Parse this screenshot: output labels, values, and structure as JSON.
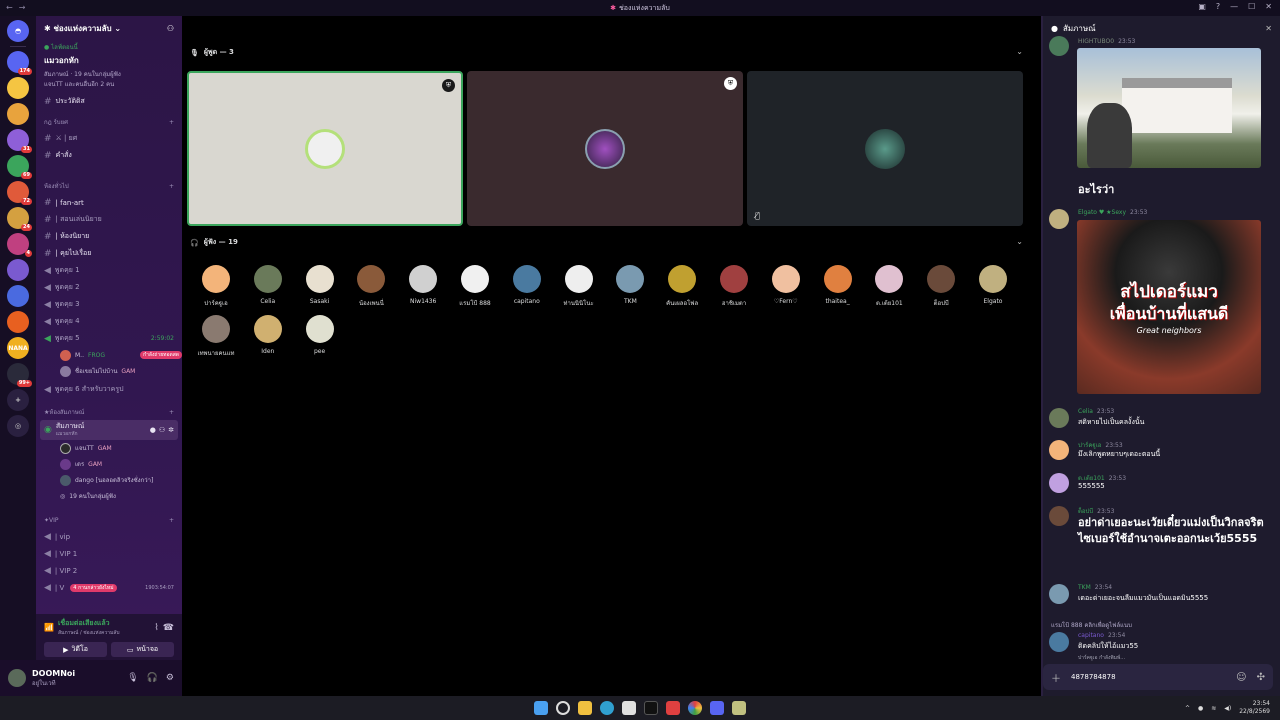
{
  "window": {
    "title": "ช่องแห่งความลับ"
  },
  "servers": [
    {
      "badge": "174",
      "color": "#5865f2"
    },
    {
      "badge": "",
      "color": "#f5c542"
    },
    {
      "badge": "",
      "color": "#e8a33d"
    },
    {
      "badge": "31",
      "color": "#8e5fd8"
    },
    {
      "badge": "69",
      "color": "#3ba55c"
    },
    {
      "badge": "72",
      "color": "#e05a3a"
    },
    {
      "badge": "24",
      "color": "#d4a040"
    },
    {
      "badge": "4",
      "color": "#c04080"
    },
    {
      "badge": "",
      "color": "#7a5ad0"
    },
    {
      "badge": "",
      "color": "#4a6ae0"
    },
    {
      "badge": "",
      "color": "#e86020"
    },
    {
      "badge": "",
      "color": "#f0b020",
      "label": "NANA"
    },
    {
      "badge": "99+",
      "color": "#2a2a3a"
    }
  ],
  "sidebar": {
    "server_name": "ช่องแห่งความลับ",
    "event": {
      "live": "● ไลฟ์ตอนนี้",
      "title": "แมวอกหัก",
      "line1": "สัมภาษณ์ · 19 คนในกลุ่มผู้ฟัง",
      "line2": "แจนTT และคนอื่นอีก 2 คน"
    },
    "history": "ประวัติดิส",
    "cat_rules": "กฎ ร์บยศ",
    "rules_items": [
      "⚔ | ยศ",
      "คำสั่ง"
    ],
    "cat_general": "ห้องทั่วไป",
    "general_items": [
      "| fan-art",
      "| สอนเล่นนิยาย",
      "| ห้องนิยาย",
      "| คุยไปเรื่อย"
    ],
    "voice_items": [
      "พูดคุย 1",
      "พูดคุย 2",
      "พูดคุย 3",
      "พูดคุย 4",
      "พูดคุย 5"
    ],
    "voice5_time": "2:59:02",
    "voice5_users": [
      {
        "name": "M..",
        "tag": "FROG",
        "live": "กำลังถ่ายทอดสด"
      },
      {
        "name": "ชื่อเขยไม่ไปบ้าน",
        "tag": "GAM"
      }
    ],
    "voice6": "พูดคุย 6 สำหรับวาครูป",
    "cat_stage": "ห้องสัมภาษณ์",
    "stage_name": "สัมภาษณ์",
    "stage_sub": "แมวอกหัก",
    "stage_users": [
      {
        "name": "แจนTT",
        "tag": "GAM"
      },
      {
        "name": "เดร",
        "tag": "GAM"
      },
      {
        "name": "dango [นอลอดลิวจริงซั่งกว่า]",
        "tag": ""
      },
      {
        "name": "19 คนในกลุ่มผู้ฟัง",
        "tag": ""
      }
    ],
    "cat_vip": "VIP",
    "vip_items": [
      "| vip",
      "| VIP 1",
      "| VIP 2",
      "| V"
    ],
    "vip_tag": "4 กานกล่าวยังไหม่",
    "vip_time": "1903:54:07"
  },
  "voice_connection": {
    "status": "เชื่อมต่อเสียงแล้ว",
    "sub": "สัมภาษณ์ / ช่องแห่งความลับ",
    "video_btn": "วิดีโอ",
    "screen_btn": "หน้าจอ"
  },
  "user": {
    "name": "DOOMNoi",
    "status": "อยู่ในเวที"
  },
  "stage": {
    "speakers_label": "ผู้พูด — 3",
    "listeners_label": "ผู้ฟัง — 19",
    "speaker_colors": [
      "#d9d7d0",
      "#3a2a2e",
      "#1f2328"
    ],
    "listeners": [
      {
        "name": "ปาร์คฐูเอ",
        "color": "#f3b47a"
      },
      {
        "name": "Celia",
        "color": "#6a7a5a"
      },
      {
        "name": "Sasaki",
        "color": "#e8e0d0"
      },
      {
        "name": "น้องเพนนี่",
        "color": "#8a5a3a"
      },
      {
        "name": "Niw1436",
        "color": "#d0d0d0"
      },
      {
        "name": "แรมโป้ 888",
        "color": "#f0f0f0"
      },
      {
        "name": "capitano",
        "color": "#4a7aa0"
      },
      {
        "name": "ท่านนินิโนะ",
        "color": "#eeeeee"
      },
      {
        "name": "TKM",
        "color": "#7a9ab0"
      },
      {
        "name": "คันเผลอโฟล",
        "color": "#c0a030"
      },
      {
        "name": "ฮาชิเมตา",
        "color": "#a04040"
      },
      {
        "name": "♡Fern♡",
        "color": "#f0c0a0"
      },
      {
        "name": "thaitea_",
        "color": "#e08040"
      },
      {
        "name": "ต.เต้ย101",
        "color": "#e0c0d0"
      },
      {
        "name": "ต็อปบี",
        "color": "#6a4a3a"
      },
      {
        "name": "Elgato",
        "color": "#c0b080"
      },
      {
        "name": "เทพนายคนแท",
        "color": "#8a7a70"
      },
      {
        "name": "Iden",
        "color": "#d0b070"
      },
      {
        "name": "pee",
        "color": "#e0e0d0"
      }
    ]
  },
  "chat": {
    "title": "สัมภาษณ์",
    "top_user": "HIGHTUBO0",
    "top_time": "23:53",
    "caption1": "อะไรว่า",
    "elgato": {
      "name": "Elgato",
      "time": "23:53"
    },
    "poster_title": "สไปเดอร์แมว",
    "poster_sub": "เพื่อนบ้านที่แสนดี",
    "poster_en": "Great neighbors",
    "messages": [
      {
        "name": "Celia",
        "time": "23:53",
        "text": "สติหายไปเป็นคลงั้งนั้น",
        "color": "#3ba55c",
        "av": "#6a7a5a"
      },
      {
        "name": "ปาร์คฐูเอ",
        "time": "23:53",
        "text": "มึงเลิกพูดหยาบๆเดอะตอนนี้",
        "color": "#3ba55c",
        "av": "#f3b47a"
      },
      {
        "name": "ต.เต้ย101",
        "time": "23:53",
        "text": "555555",
        "color": "#3ba55c",
        "av": "#c0a0e0"
      },
      {
        "name": "ต็อปบี",
        "time": "23:53",
        "text": "อย่าด่าเยอะนะเวัยเดี๋ยวแม่งเป็นวิกลจริตไซเบอร์ใช้อำนาจเตะออกนะเว้ย5555",
        "color": "#3ba55c",
        "av": "#6a4a3a",
        "big": true
      },
      {
        "name": "TKM",
        "time": "23:54",
        "text": "เดอะด่าเยอะจนลืมแมวมันเป็นแอดมิน5555",
        "color": "#3ba55c",
        "av": "#7a9ab0"
      },
      {
        "name": "capitano",
        "time": "23:54",
        "text": "ติดคลิปให้ไอ้แมว55",
        "color": "#7a5ad0",
        "av": "#4a7aa0"
      }
    ],
    "reply_to": "แรมโป้ 888 คลิกเพื่อดูไฟล์แนบ",
    "typing": "ปาร์คฐูเอ กำลังพิมพ์...",
    "input_value": "4878784878"
  },
  "clock": {
    "time": "23:54",
    "date": "22/8/2569"
  }
}
